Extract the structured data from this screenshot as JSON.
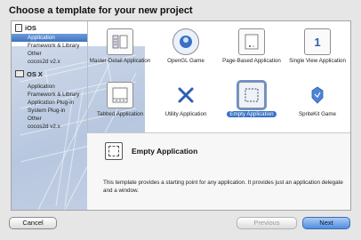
{
  "dialog": {
    "title": "Choose a template for your new project"
  },
  "sidebar": {
    "groups": [
      {
        "label": "iOS",
        "icon": "ios-device-icon",
        "items": [
          "Application",
          "Framework & Library",
          "Other",
          "cocos2d v2.x"
        ]
      },
      {
        "label": "OS X",
        "icon": "mac-display-icon",
        "items": [
          "Application",
          "Framework & Library",
          "Application Plug-in",
          "System Plug-in",
          "Other",
          "cocos2d v2.x"
        ]
      }
    ],
    "selected": "iOS / Application"
  },
  "templates": [
    {
      "label": "Master-Detail Application",
      "icon": "master-detail-icon"
    },
    {
      "label": "OpenGL Game",
      "icon": "opengl-game-icon"
    },
    {
      "label": "Page-Based Application",
      "icon": "page-based-icon"
    },
    {
      "label": "Single View Application",
      "icon": "single-view-icon",
      "badge": "1"
    },
    {
      "label": "Tabbed Application",
      "icon": "tabbed-icon"
    },
    {
      "label": "Utility Application",
      "icon": "utility-icon"
    },
    {
      "label": "Empty Application",
      "icon": "empty-application-icon",
      "selected": true
    },
    {
      "label": "SpriteKit Game",
      "icon": "spritekit-icon"
    }
  ],
  "detail": {
    "title": "Empty Application",
    "description": "This template provides a starting point for any application. It provides just an application delegate and a window."
  },
  "buttons": {
    "cancel": "Cancel",
    "previous": "Previous",
    "next": "Next"
  },
  "colors": {
    "selection": "#3b73c6",
    "panel": "#ffffff",
    "window": "#e6e6e6"
  }
}
